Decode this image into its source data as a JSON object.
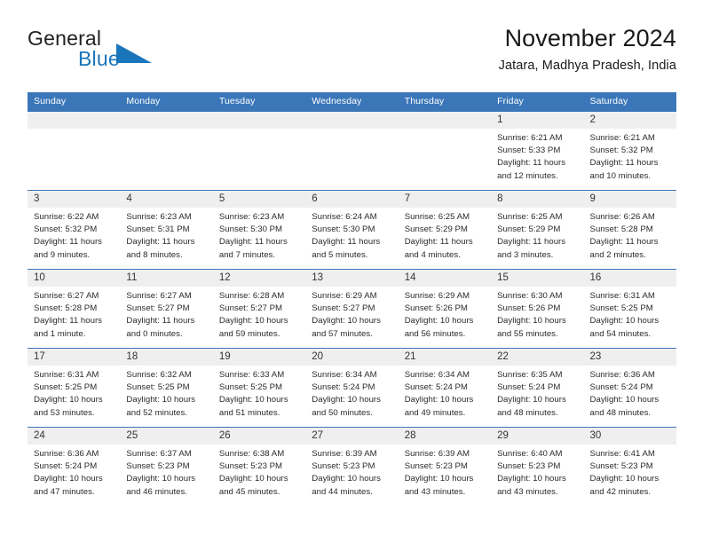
{
  "brand": {
    "word_one": "General",
    "word_two": "Blue",
    "triangle_color": "#1b75bb",
    "text_color": "#231f20",
    "blue_color": "#1b75bb"
  },
  "header": {
    "title": "November 2024",
    "location": "Jatara, Madhya Pradesh, India"
  },
  "theme": {
    "header_blue": "#3a76b8",
    "day_band_gray": "#efefef",
    "cell_white": "#ffffff",
    "text": "#2b2b2b"
  },
  "weekdays": [
    "Sunday",
    "Monday",
    "Tuesday",
    "Wednesday",
    "Thursday",
    "Friday",
    "Saturday"
  ],
  "weeks": [
    [
      {
        "day": "",
        "empty": true,
        "sunrise": "",
        "sunset": "",
        "daylight1": "",
        "daylight2": ""
      },
      {
        "day": "",
        "empty": true,
        "sunrise": "",
        "sunset": "",
        "daylight1": "",
        "daylight2": ""
      },
      {
        "day": "",
        "empty": true,
        "sunrise": "",
        "sunset": "",
        "daylight1": "",
        "daylight2": ""
      },
      {
        "day": "",
        "empty": true,
        "sunrise": "",
        "sunset": "",
        "daylight1": "",
        "daylight2": ""
      },
      {
        "day": "",
        "empty": true,
        "sunrise": "",
        "sunset": "",
        "daylight1": "",
        "daylight2": ""
      },
      {
        "day": "1",
        "empty": false,
        "sunrise": "Sunrise: 6:21 AM",
        "sunset": "Sunset: 5:33 PM",
        "daylight1": "Daylight: 11 hours",
        "daylight2": "and 12 minutes."
      },
      {
        "day": "2",
        "empty": false,
        "sunrise": "Sunrise: 6:21 AM",
        "sunset": "Sunset: 5:32 PM",
        "daylight1": "Daylight: 11 hours",
        "daylight2": "and 10 minutes."
      }
    ],
    [
      {
        "day": "3",
        "empty": false,
        "sunrise": "Sunrise: 6:22 AM",
        "sunset": "Sunset: 5:32 PM",
        "daylight1": "Daylight: 11 hours",
        "daylight2": "and 9 minutes."
      },
      {
        "day": "4",
        "empty": false,
        "sunrise": "Sunrise: 6:23 AM",
        "sunset": "Sunset: 5:31 PM",
        "daylight1": "Daylight: 11 hours",
        "daylight2": "and 8 minutes."
      },
      {
        "day": "5",
        "empty": false,
        "sunrise": "Sunrise: 6:23 AM",
        "sunset": "Sunset: 5:30 PM",
        "daylight1": "Daylight: 11 hours",
        "daylight2": "and 7 minutes."
      },
      {
        "day": "6",
        "empty": false,
        "sunrise": "Sunrise: 6:24 AM",
        "sunset": "Sunset: 5:30 PM",
        "daylight1": "Daylight: 11 hours",
        "daylight2": "and 5 minutes."
      },
      {
        "day": "7",
        "empty": false,
        "sunrise": "Sunrise: 6:25 AM",
        "sunset": "Sunset: 5:29 PM",
        "daylight1": "Daylight: 11 hours",
        "daylight2": "and 4 minutes."
      },
      {
        "day": "8",
        "empty": false,
        "sunrise": "Sunrise: 6:25 AM",
        "sunset": "Sunset: 5:29 PM",
        "daylight1": "Daylight: 11 hours",
        "daylight2": "and 3 minutes."
      },
      {
        "day": "9",
        "empty": false,
        "sunrise": "Sunrise: 6:26 AM",
        "sunset": "Sunset: 5:28 PM",
        "daylight1": "Daylight: 11 hours",
        "daylight2": "and 2 minutes."
      }
    ],
    [
      {
        "day": "10",
        "empty": false,
        "sunrise": "Sunrise: 6:27 AM",
        "sunset": "Sunset: 5:28 PM",
        "daylight1": "Daylight: 11 hours",
        "daylight2": "and 1 minute."
      },
      {
        "day": "11",
        "empty": false,
        "sunrise": "Sunrise: 6:27 AM",
        "sunset": "Sunset: 5:27 PM",
        "daylight1": "Daylight: 11 hours",
        "daylight2": "and 0 minutes."
      },
      {
        "day": "12",
        "empty": false,
        "sunrise": "Sunrise: 6:28 AM",
        "sunset": "Sunset: 5:27 PM",
        "daylight1": "Daylight: 10 hours",
        "daylight2": "and 59 minutes."
      },
      {
        "day": "13",
        "empty": false,
        "sunrise": "Sunrise: 6:29 AM",
        "sunset": "Sunset: 5:27 PM",
        "daylight1": "Daylight: 10 hours",
        "daylight2": "and 57 minutes."
      },
      {
        "day": "14",
        "empty": false,
        "sunrise": "Sunrise: 6:29 AM",
        "sunset": "Sunset: 5:26 PM",
        "daylight1": "Daylight: 10 hours",
        "daylight2": "and 56 minutes."
      },
      {
        "day": "15",
        "empty": false,
        "sunrise": "Sunrise: 6:30 AM",
        "sunset": "Sunset: 5:26 PM",
        "daylight1": "Daylight: 10 hours",
        "daylight2": "and 55 minutes."
      },
      {
        "day": "16",
        "empty": false,
        "sunrise": "Sunrise: 6:31 AM",
        "sunset": "Sunset: 5:25 PM",
        "daylight1": "Daylight: 10 hours",
        "daylight2": "and 54 minutes."
      }
    ],
    [
      {
        "day": "17",
        "empty": false,
        "sunrise": "Sunrise: 6:31 AM",
        "sunset": "Sunset: 5:25 PM",
        "daylight1": "Daylight: 10 hours",
        "daylight2": "and 53 minutes."
      },
      {
        "day": "18",
        "empty": false,
        "sunrise": "Sunrise: 6:32 AM",
        "sunset": "Sunset: 5:25 PM",
        "daylight1": "Daylight: 10 hours",
        "daylight2": "and 52 minutes."
      },
      {
        "day": "19",
        "empty": false,
        "sunrise": "Sunrise: 6:33 AM",
        "sunset": "Sunset: 5:25 PM",
        "daylight1": "Daylight: 10 hours",
        "daylight2": "and 51 minutes."
      },
      {
        "day": "20",
        "empty": false,
        "sunrise": "Sunrise: 6:34 AM",
        "sunset": "Sunset: 5:24 PM",
        "daylight1": "Daylight: 10 hours",
        "daylight2": "and 50 minutes."
      },
      {
        "day": "21",
        "empty": false,
        "sunrise": "Sunrise: 6:34 AM",
        "sunset": "Sunset: 5:24 PM",
        "daylight1": "Daylight: 10 hours",
        "daylight2": "and 49 minutes."
      },
      {
        "day": "22",
        "empty": false,
        "sunrise": "Sunrise: 6:35 AM",
        "sunset": "Sunset: 5:24 PM",
        "daylight1": "Daylight: 10 hours",
        "daylight2": "and 48 minutes."
      },
      {
        "day": "23",
        "empty": false,
        "sunrise": "Sunrise: 6:36 AM",
        "sunset": "Sunset: 5:24 PM",
        "daylight1": "Daylight: 10 hours",
        "daylight2": "and 48 minutes."
      }
    ],
    [
      {
        "day": "24",
        "empty": false,
        "sunrise": "Sunrise: 6:36 AM",
        "sunset": "Sunset: 5:24 PM",
        "daylight1": "Daylight: 10 hours",
        "daylight2": "and 47 minutes."
      },
      {
        "day": "25",
        "empty": false,
        "sunrise": "Sunrise: 6:37 AM",
        "sunset": "Sunset: 5:23 PM",
        "daylight1": "Daylight: 10 hours",
        "daylight2": "and 46 minutes."
      },
      {
        "day": "26",
        "empty": false,
        "sunrise": "Sunrise: 6:38 AM",
        "sunset": "Sunset: 5:23 PM",
        "daylight1": "Daylight: 10 hours",
        "daylight2": "and 45 minutes."
      },
      {
        "day": "27",
        "empty": false,
        "sunrise": "Sunrise: 6:39 AM",
        "sunset": "Sunset: 5:23 PM",
        "daylight1": "Daylight: 10 hours",
        "daylight2": "and 44 minutes."
      },
      {
        "day": "28",
        "empty": false,
        "sunrise": "Sunrise: 6:39 AM",
        "sunset": "Sunset: 5:23 PM",
        "daylight1": "Daylight: 10 hours",
        "daylight2": "and 43 minutes."
      },
      {
        "day": "29",
        "empty": false,
        "sunrise": "Sunrise: 6:40 AM",
        "sunset": "Sunset: 5:23 PM",
        "daylight1": "Daylight: 10 hours",
        "daylight2": "and 43 minutes."
      },
      {
        "day": "30",
        "empty": false,
        "sunrise": "Sunrise: 6:41 AM",
        "sunset": "Sunset: 5:23 PM",
        "daylight1": "Daylight: 10 hours",
        "daylight2": "and 42 minutes."
      }
    ]
  ]
}
